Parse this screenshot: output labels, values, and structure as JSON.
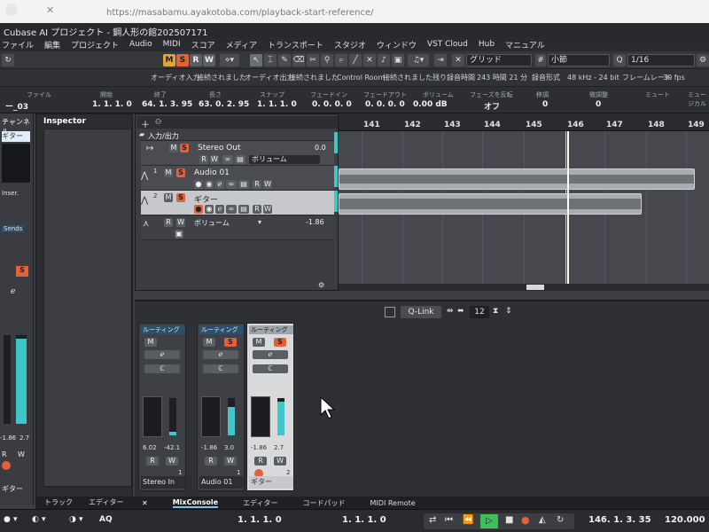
{
  "browser": {
    "url": "https://masabamu.ayakotoba.com/playback-start-reference/"
  },
  "window": {
    "title": "Cubase AI プロジェクト - 鋼人形の館202507171"
  },
  "menu": [
    "ファイル",
    "編集",
    "プロジェクト",
    "Audio",
    "MIDI",
    "スコア",
    "メディア",
    "トランスポート",
    "スタジオ",
    "ウィンドウ",
    "VST Cloud",
    "Hub",
    "マニュアル"
  ],
  "toolbar": {
    "m": "M",
    "s": "S",
    "r": "R",
    "w": "W",
    "snap_type": "グリッド",
    "grid_type": "小節",
    "quantize": "1/16"
  },
  "status_chips": [
    "オーディオ入力",
    "接続されました",
    "オーディオ出力",
    "接続されました",
    "Control Room",
    "接続されました",
    "残り録音時間",
    "243 時間 21 分",
    "録音形式",
    "48 kHz - 24 bit",
    "フレームレート",
    "30 fps"
  ],
  "infoline": {
    "headers": [
      "ファイル",
      "開始",
      "終了",
      "長さ",
      "スナップ",
      "フェードイン",
      "フェードアウト",
      "ボリューム",
      "フェーズを反転",
      "移調",
      "微調整",
      "ミュート",
      "ミュージカル"
    ],
    "values": [
      "ー_03",
      "1. 1. 1. 0",
      "64. 1. 3. 95",
      "63. 0. 2. 95",
      "1. 1. 1. 0",
      "0. 0. 0. 0",
      "0. 0. 0. 0",
      "0.00 dB",
      "オフ",
      "0",
      "0",
      "",
      ""
    ]
  },
  "left_strip": {
    "title": "チャンネル",
    "insert": "Inser.",
    "sends": "Sends",
    "vals": [
      "-1.86",
      "2.7"
    ],
    "name": "ギター"
  },
  "inspector": {
    "title": "Inspector"
  },
  "tracks": {
    "folder_label": "入力/出力",
    "stereo_out": {
      "name": "Stereo Out",
      "value": "0.0",
      "automation": "ボリューム"
    },
    "audio01": {
      "index": "1",
      "name": "Audio 01"
    },
    "guitar": {
      "index": "2",
      "name": "ギター"
    },
    "auto_track": {
      "param": "ボリューム",
      "value": "-1.86"
    }
  },
  "ruler": {
    "bars": [
      "141",
      "142",
      "143",
      "144",
      "145",
      "146",
      "147",
      "148",
      "149"
    ]
  },
  "qlink": {
    "label": "Q-Link",
    "value": "12"
  },
  "mixer": {
    "routing": "ルーティング",
    "channels": [
      {
        "name": "Stereo In",
        "vals": [
          "6.02",
          "-42.1"
        ],
        "num": "1",
        "level": 0.1
      },
      {
        "name": "Audio 01",
        "vals": [
          "-1.86",
          "3.0"
        ],
        "num": "1",
        "level": 0.75
      },
      {
        "name": "ギター",
        "vals": [
          "-1.86",
          "2.7"
        ],
        "num": "2",
        "level": 0.9
      }
    ]
  },
  "tabs_left": [
    "トラック",
    "エディター"
  ],
  "tabs": [
    "MixConsole",
    "エディター",
    "コードパッド",
    "MIDI Remote"
  ],
  "transport": {
    "left_locator": "1. 1. 1. 0",
    "right_locator": "1. 1. 1. 0",
    "position": "146. 1. 3. 35",
    "tempo": "120.000",
    "aq": "AQ"
  },
  "colors": {
    "mute": "#e2a43a",
    "solo": "#e0613a",
    "meter": "#3fc6c9",
    "event": "#a8abb0"
  }
}
